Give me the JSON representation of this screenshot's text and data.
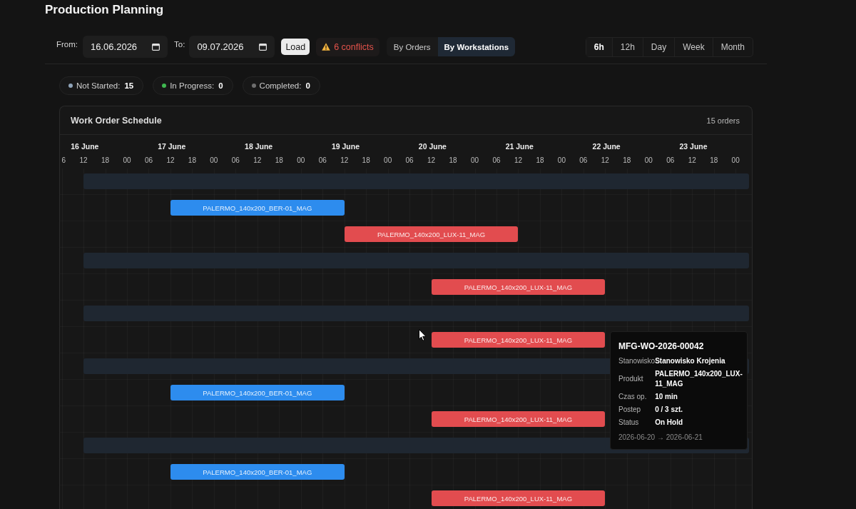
{
  "page": {
    "title": "Production Planning"
  },
  "filters": {
    "from_label": "From:",
    "from_value": "16.06.2026",
    "to_label": "To:",
    "to_value": "09.07.2026",
    "load_button": "Load",
    "conflicts": "6 conflicts"
  },
  "view_modes": [
    {
      "label": "By Orders",
      "selected": false
    },
    {
      "label": "By Workstations",
      "selected": true
    }
  ],
  "scales": [
    {
      "label": "6h",
      "selected": true
    },
    {
      "label": "12h",
      "selected": false
    },
    {
      "label": "Day",
      "selected": false
    },
    {
      "label": "Week",
      "selected": false
    },
    {
      "label": "Month",
      "selected": false
    }
  ],
  "status_counts": [
    {
      "label": "Not Started:",
      "count": "15",
      "color": "#8fa3b8"
    },
    {
      "label": "In Progress:",
      "count": "0",
      "color": "#3fb950"
    },
    {
      "label": "Completed:",
      "count": "0",
      "color": "#6e6e6e"
    }
  ],
  "schedule": {
    "title": "Work Order Schedule",
    "count": "15 orders",
    "days": [
      "16 June",
      "17 June",
      "18 June",
      "19 June",
      "20 June",
      "21 June",
      "22 June",
      "23 June"
    ],
    "hour_ticks": [
      "6",
      "12",
      "18",
      "00",
      "06",
      "12",
      "18",
      "00",
      "06",
      "12",
      "18",
      "00",
      "06",
      "12",
      "18",
      "00",
      "06",
      "12",
      "18",
      "00",
      "06",
      "12",
      "18",
      "00",
      "06",
      "12",
      "18",
      "00",
      "06",
      "12",
      "18",
      "00"
    ],
    "rows": [
      {
        "kind": "group"
      },
      {
        "kind": "order",
        "label": "PALERMO_140x200_BER-01_MAG",
        "color": "#2d8cee"
      },
      {
        "kind": "order",
        "label": "PALERMO_140x200_LUX-11_MAG",
        "color": "#e24c4f"
      },
      {
        "kind": "group"
      },
      {
        "kind": "order",
        "label": "PALERMO_140x200_LUX-11_MAG",
        "color": "#e24c4f"
      },
      {
        "kind": "group"
      },
      {
        "kind": "order",
        "label": "PALERMO_140x200_LUX-11_MAG",
        "color": "#e24c4f"
      },
      {
        "kind": "group"
      },
      {
        "kind": "order",
        "label": "PALERMO_140x200_BER-01_MAG",
        "color": "#2d8cee"
      },
      {
        "kind": "order",
        "label": "PALERMO_140x200_LUX-11_MAG",
        "color": "#e24c4f"
      },
      {
        "kind": "group"
      },
      {
        "kind": "order",
        "label": "PALERMO_140x200_BER-01_MAG",
        "color": "#2d8cee"
      },
      {
        "kind": "order",
        "label": "PALERMO_140x200_LUX-11_MAG",
        "color": "#e24c4f"
      }
    ]
  },
  "tooltip": {
    "title": "MFG-WO-2026-00042",
    "fields": [
      {
        "label": "Stanowisko",
        "value": "Stanowisko Krojenia"
      },
      {
        "label": "Produkt",
        "value": "PALERMO_140x200_LUX-11_MAG"
      },
      {
        "label": "Czas op.",
        "value": "10 min"
      },
      {
        "label": "Postep",
        "value": "0 / 3 szt."
      },
      {
        "label": "Status",
        "value": "On Hold"
      }
    ],
    "dates": "2026-06-20 → 2026-06-21"
  }
}
